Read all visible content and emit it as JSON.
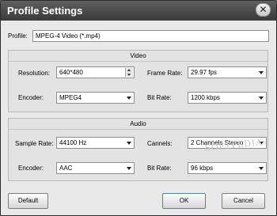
{
  "window": {
    "title": "Profile Settings",
    "close_glyph": "✕"
  },
  "profile": {
    "label": "Profile:",
    "value": "MPEG-4 Video (*.mp4)"
  },
  "video": {
    "heading": "Video",
    "resolution": {
      "label": "Resolution:",
      "value": "640*480"
    },
    "frame_rate": {
      "label": "Frame Rate:",
      "value": "29.97 fps"
    },
    "encoder": {
      "label": "Encoder:",
      "value": "MPEG4"
    },
    "bit_rate": {
      "label": "Bit Rate:",
      "value": "1200 kbps"
    }
  },
  "audio": {
    "heading": "Audio",
    "sample_rate": {
      "label": "Sample Rate:",
      "value": "44100 Hz"
    },
    "channels": {
      "label": "Cannels:",
      "value": "2 Channels Stereo"
    },
    "encoder": {
      "label": "Encoder:",
      "value": "AAC"
    },
    "bit_rate": {
      "label": "Bit Rate:",
      "value": "96 kbps"
    }
  },
  "buttons": {
    "default": "Default",
    "ok": "OK",
    "cancel": "Cancel"
  },
  "watermark": "SOFTPEDIA"
}
